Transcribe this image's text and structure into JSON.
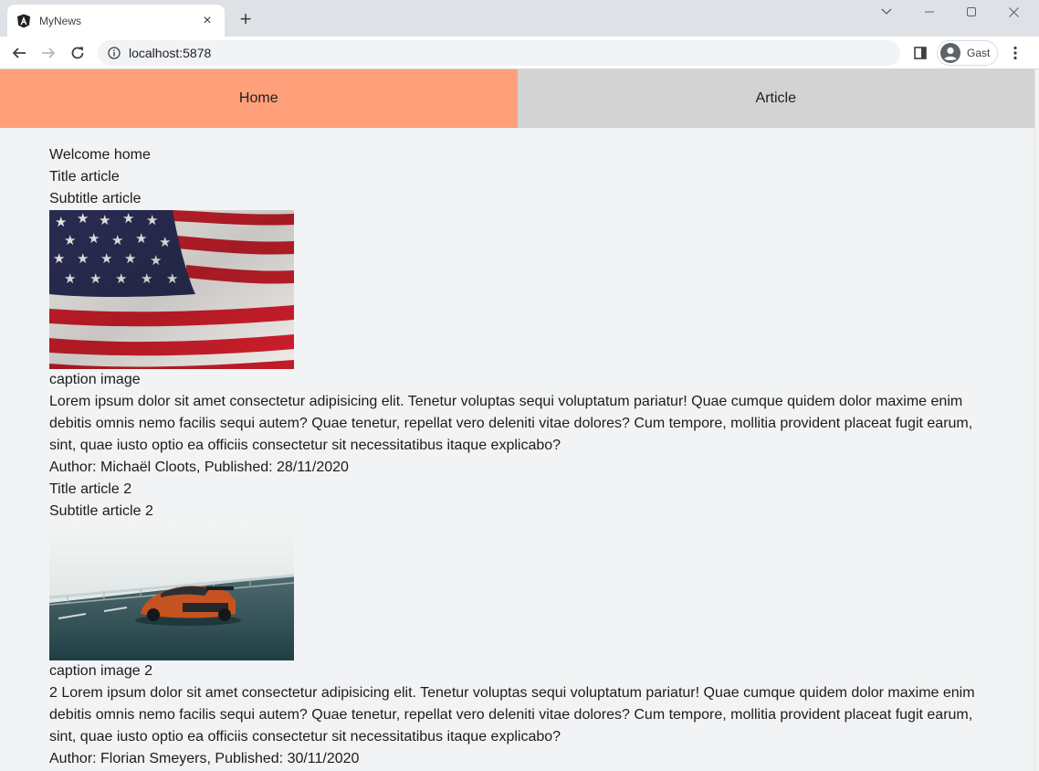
{
  "browser": {
    "tab_title": "MyNews",
    "url": "localhost:5878",
    "profile_name": "Gast"
  },
  "nav": {
    "home": "Home",
    "article": "Article"
  },
  "page": {
    "welcome": "Welcome home",
    "articles": [
      {
        "title": "Title article",
        "subtitle": "Subtitle article",
        "image_desc": "american-flag-photo",
        "caption": "caption image",
        "body": "Lorem ipsum dolor sit amet consectetur adipisicing elit. Tenetur voluptas sequi voluptatum pariatur! Quae cumque quidem dolor maxime enim debitis omnis nemo facilis sequi autem? Quae tenetur, repellat vero deleniti vitae dolores? Cum tempore, mollitia provident placeat fugit earum, sint, quae iusto optio ea officiis consectetur sit necessitatibus itaque explicabo?",
        "byline": "Author: Michaël Cloots, Published: 28/11/2020"
      },
      {
        "title": "Title article 2",
        "subtitle": "Subtitle article 2",
        "image_desc": "sports-car-photo",
        "caption": "caption image 2",
        "body": "2 Lorem ipsum dolor sit amet consectetur adipisicing elit. Tenetur voluptas sequi voluptatum pariatur! Quae cumque quidem dolor maxime enim debitis omnis nemo facilis sequi autem? Quae tenetur, repellat vero deleniti vitae dolores? Cum tempore, mollitia provident placeat fugit earum, sint, quae iusto optio ea officiis consectetur sit necessitatibus itaque explicabo?",
        "byline": "Author: Florian Smeyers, Published: 30/11/2020"
      }
    ]
  },
  "colors": {
    "nav_active": "#ffa07a",
    "nav_inactive": "#d3d3d3",
    "page_bg": "#f2f3f5"
  }
}
